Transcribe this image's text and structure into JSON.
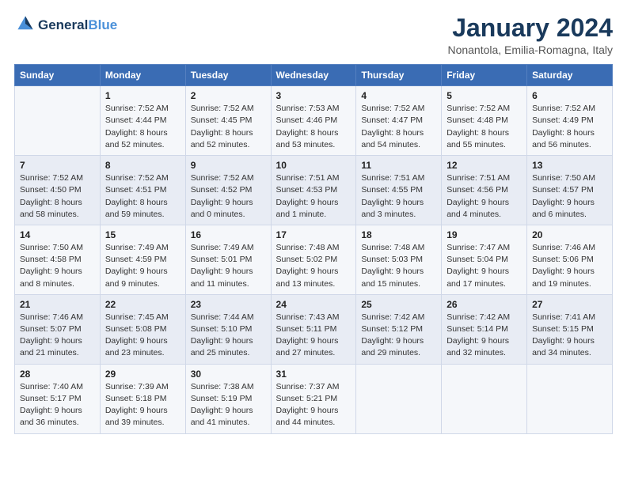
{
  "header": {
    "logo_line1": "General",
    "logo_line2": "Blue",
    "month": "January 2024",
    "location": "Nonantola, Emilia-Romagna, Italy"
  },
  "weekdays": [
    "Sunday",
    "Monday",
    "Tuesday",
    "Wednesday",
    "Thursday",
    "Friday",
    "Saturday"
  ],
  "weeks": [
    [
      {
        "num": "",
        "info": ""
      },
      {
        "num": "1",
        "info": "Sunrise: 7:52 AM\nSunset: 4:44 PM\nDaylight: 8 hours\nand 52 minutes."
      },
      {
        "num": "2",
        "info": "Sunrise: 7:52 AM\nSunset: 4:45 PM\nDaylight: 8 hours\nand 52 minutes."
      },
      {
        "num": "3",
        "info": "Sunrise: 7:53 AM\nSunset: 4:46 PM\nDaylight: 8 hours\nand 53 minutes."
      },
      {
        "num": "4",
        "info": "Sunrise: 7:52 AM\nSunset: 4:47 PM\nDaylight: 8 hours\nand 54 minutes."
      },
      {
        "num": "5",
        "info": "Sunrise: 7:52 AM\nSunset: 4:48 PM\nDaylight: 8 hours\nand 55 minutes."
      },
      {
        "num": "6",
        "info": "Sunrise: 7:52 AM\nSunset: 4:49 PM\nDaylight: 8 hours\nand 56 minutes."
      }
    ],
    [
      {
        "num": "7",
        "info": "Sunrise: 7:52 AM\nSunset: 4:50 PM\nDaylight: 8 hours\nand 58 minutes."
      },
      {
        "num": "8",
        "info": "Sunrise: 7:52 AM\nSunset: 4:51 PM\nDaylight: 8 hours\nand 59 minutes."
      },
      {
        "num": "9",
        "info": "Sunrise: 7:52 AM\nSunset: 4:52 PM\nDaylight: 9 hours\nand 0 minutes."
      },
      {
        "num": "10",
        "info": "Sunrise: 7:51 AM\nSunset: 4:53 PM\nDaylight: 9 hours\nand 1 minute."
      },
      {
        "num": "11",
        "info": "Sunrise: 7:51 AM\nSunset: 4:55 PM\nDaylight: 9 hours\nand 3 minutes."
      },
      {
        "num": "12",
        "info": "Sunrise: 7:51 AM\nSunset: 4:56 PM\nDaylight: 9 hours\nand 4 minutes."
      },
      {
        "num": "13",
        "info": "Sunrise: 7:50 AM\nSunset: 4:57 PM\nDaylight: 9 hours\nand 6 minutes."
      }
    ],
    [
      {
        "num": "14",
        "info": "Sunrise: 7:50 AM\nSunset: 4:58 PM\nDaylight: 9 hours\nand 8 minutes."
      },
      {
        "num": "15",
        "info": "Sunrise: 7:49 AM\nSunset: 4:59 PM\nDaylight: 9 hours\nand 9 minutes."
      },
      {
        "num": "16",
        "info": "Sunrise: 7:49 AM\nSunset: 5:01 PM\nDaylight: 9 hours\nand 11 minutes."
      },
      {
        "num": "17",
        "info": "Sunrise: 7:48 AM\nSunset: 5:02 PM\nDaylight: 9 hours\nand 13 minutes."
      },
      {
        "num": "18",
        "info": "Sunrise: 7:48 AM\nSunset: 5:03 PM\nDaylight: 9 hours\nand 15 minutes."
      },
      {
        "num": "19",
        "info": "Sunrise: 7:47 AM\nSunset: 5:04 PM\nDaylight: 9 hours\nand 17 minutes."
      },
      {
        "num": "20",
        "info": "Sunrise: 7:46 AM\nSunset: 5:06 PM\nDaylight: 9 hours\nand 19 minutes."
      }
    ],
    [
      {
        "num": "21",
        "info": "Sunrise: 7:46 AM\nSunset: 5:07 PM\nDaylight: 9 hours\nand 21 minutes."
      },
      {
        "num": "22",
        "info": "Sunrise: 7:45 AM\nSunset: 5:08 PM\nDaylight: 9 hours\nand 23 minutes."
      },
      {
        "num": "23",
        "info": "Sunrise: 7:44 AM\nSunset: 5:10 PM\nDaylight: 9 hours\nand 25 minutes."
      },
      {
        "num": "24",
        "info": "Sunrise: 7:43 AM\nSunset: 5:11 PM\nDaylight: 9 hours\nand 27 minutes."
      },
      {
        "num": "25",
        "info": "Sunrise: 7:42 AM\nSunset: 5:12 PM\nDaylight: 9 hours\nand 29 minutes."
      },
      {
        "num": "26",
        "info": "Sunrise: 7:42 AM\nSunset: 5:14 PM\nDaylight: 9 hours\nand 32 minutes."
      },
      {
        "num": "27",
        "info": "Sunrise: 7:41 AM\nSunset: 5:15 PM\nDaylight: 9 hours\nand 34 minutes."
      }
    ],
    [
      {
        "num": "28",
        "info": "Sunrise: 7:40 AM\nSunset: 5:17 PM\nDaylight: 9 hours\nand 36 minutes."
      },
      {
        "num": "29",
        "info": "Sunrise: 7:39 AM\nSunset: 5:18 PM\nDaylight: 9 hours\nand 39 minutes."
      },
      {
        "num": "30",
        "info": "Sunrise: 7:38 AM\nSunset: 5:19 PM\nDaylight: 9 hours\nand 41 minutes."
      },
      {
        "num": "31",
        "info": "Sunrise: 7:37 AM\nSunset: 5:21 PM\nDaylight: 9 hours\nand 44 minutes."
      },
      {
        "num": "",
        "info": ""
      },
      {
        "num": "",
        "info": ""
      },
      {
        "num": "",
        "info": ""
      }
    ]
  ]
}
